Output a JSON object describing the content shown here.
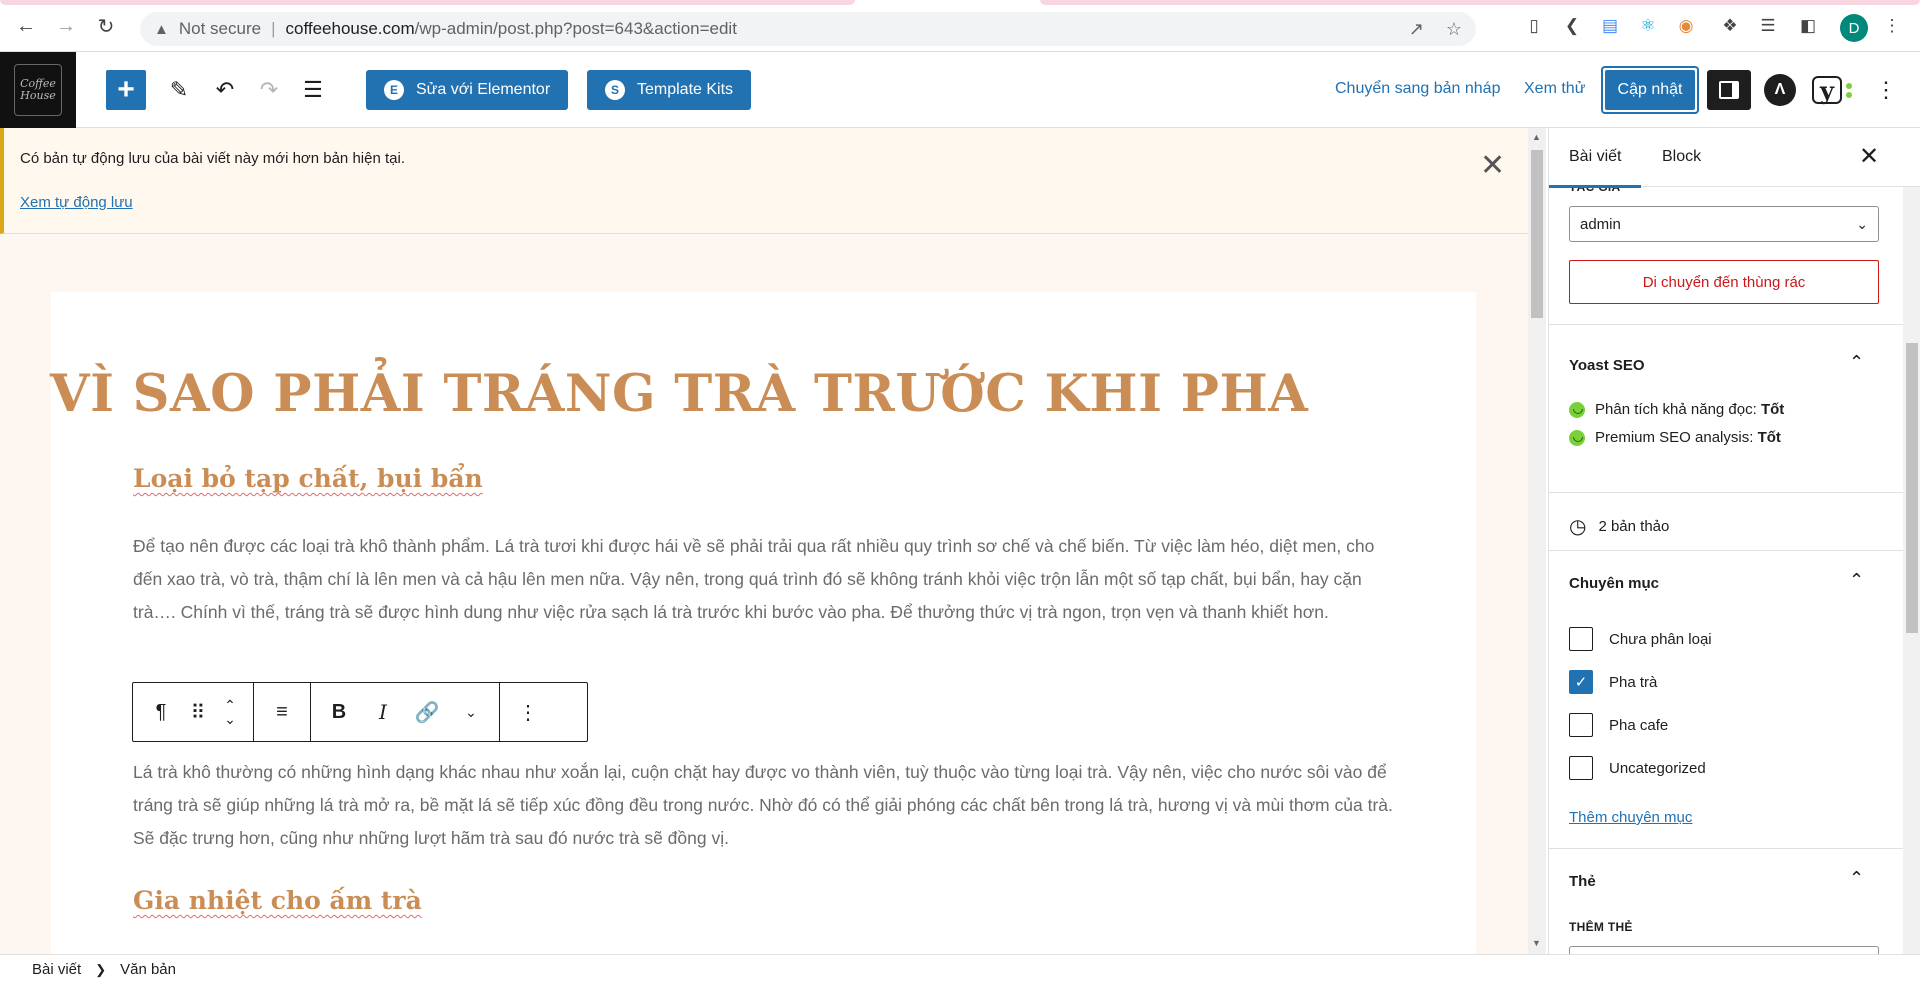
{
  "browser": {
    "security": "Not secure",
    "url_host": "coffeehouse.com",
    "url_path": "/wp-admin/post.php?post=643&action=edit",
    "profile_initial": "D"
  },
  "toolbar": {
    "site_logo_text": "Coffee House",
    "elementor_label": "Sửa với Elementor",
    "template_kits_label": "Template Kits",
    "switch_draft_label": "Chuyển sang bản nháp",
    "preview_label": "Xem thử",
    "update_label": "Cập nhật"
  },
  "notice": {
    "message": "Có bản tự động lưu của bài viết này mới hơn bản hiện tại.",
    "link": "Xem tự động lưu"
  },
  "post": {
    "title": "VÌ SAO PHẢI TRÁNG TRÀ TRƯỚC KHI PHA",
    "h2_1": "Loại bỏ tạp chất, bụi bẩn",
    "p1": "Để tạo nên được các loại trà khô thành phẩm. Lá trà tươi khi được hái về sẽ phải trải qua rất nhiều quy trình sơ chế và chế biến. Từ việc làm héo, diệt men, cho đến xao trà, vò trà, thậm chí là lên men và cả hậu lên men nữa. Vậy nên, trong quá trình đó sẽ không tránh khỏi việc trộn lẫn một số tạp chất, bụi bẩn, hay cặn trà…. Chính vì thế, tráng trà sẽ được hình dung như việc rửa sạch lá trà trước khi bước vào pha. Để thưởng thức vị trà ngon, trọn vẹn và thanh khiết hơn.",
    "p2": "Lá trà khô thường có những hình dạng khác nhau như xoắn lại, cuộn chặt hay được vo thành viên, tuỳ thuộc vào từng loại trà. Vậy nên, việc cho nước sôi vào để tráng trà sẽ giúp những lá trà mở ra, bề mặt lá sẽ tiếp xúc đồng đều trong nước. Nhờ đó có thể giải phóng các chất bên trong lá trà, hương vị và mùi thơm của trà. Sẽ đặc trưng hơn, cũng như những lượt hãm trà sau đó nước trà sẽ đồng vị.",
    "h2_2": "Gia nhiệt cho ấm trà"
  },
  "sidebar": {
    "tab_post": "Bài viết",
    "tab_block": "Block",
    "author_label": "TÁC GIẢ",
    "author_value": "admin",
    "trash_label": "Di chuyển đến thùng rác",
    "yoast_title": "Yoast SEO",
    "readability_label": "Phân tích khả năng đọc:",
    "readability_value": "Tốt",
    "seo_label": "Premium SEO analysis:",
    "seo_value": "Tốt",
    "revisions": "2 bản thảo",
    "categories_title": "Chuyên mục",
    "categories": [
      {
        "label": "Chưa phân loại",
        "checked": false
      },
      {
        "label": "Pha trà",
        "checked": true
      },
      {
        "label": "Pha cafe",
        "checked": false
      },
      {
        "label": "Uncategorized",
        "checked": false
      }
    ],
    "add_category": "Thêm chuyên mục",
    "tags_title": "Thẻ",
    "add_tag_label": "THÊM THẺ"
  },
  "breadcrumb": {
    "item1": "Bài viết",
    "item2": "Văn bản"
  },
  "colors": {
    "wp_blue": "#2271b1",
    "heading_brown": "#c98d55",
    "danger": "#cc1818",
    "notice_border": "#dba617"
  }
}
